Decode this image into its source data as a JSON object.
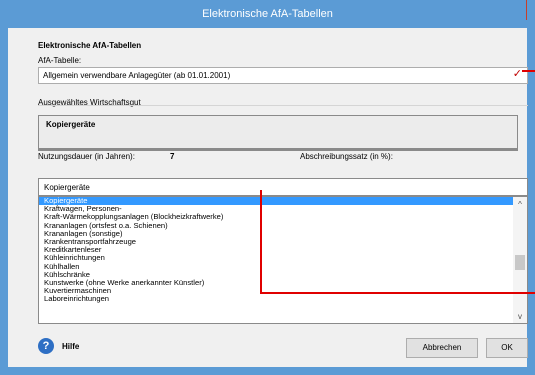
{
  "window": {
    "title": "Elektronische AfA-Tabellen"
  },
  "form": {
    "heading": "Elektronische AfA-Tabellen",
    "afa_table_label": "AfA-Tabelle:",
    "afa_table_value": "Allgemein verwendbare Anlagegüter (ab 01.01.2001)",
    "selected_group_label": "Ausgewähltes Wirtschaftsgut",
    "selected_item": "Kopiergeräte",
    "nutzungsdauer_label": "Nutzungsdauer (in Jahren):",
    "nutzungsdauer_value": "7",
    "abschreibungssatz_label": "Abschreibungssatz (in %):",
    "search_value": "Kopiergeräte"
  },
  "list": {
    "items": [
      "Kopiergeräte",
      "Kraftwagen, Personen-",
      "Kraft-Wärmekopplungsanlagen (Blockheizkraftwerke)",
      "Krananlagen (ortsfest o.a. Schienen)",
      "Krananlagen (sonstige)",
      "Krankentransportfahrzeuge",
      "Kreditkartenleser",
      "Kühleinrichtungen",
      "Kühlhallen",
      "Kühlschränke",
      "Kunstwerke (ohne Werke anerkannter Künstler)",
      "Kuvertiermaschinen",
      "Laboreinrichtungen"
    ],
    "selected_index": 0
  },
  "footer": {
    "help_label": "Hilfe",
    "cancel_label": "Abbrechen",
    "ok_label": "OK"
  },
  "colors": {
    "titlebar": "#5b9bd5",
    "selection": "#3399ff",
    "annotation": "#e00000"
  }
}
